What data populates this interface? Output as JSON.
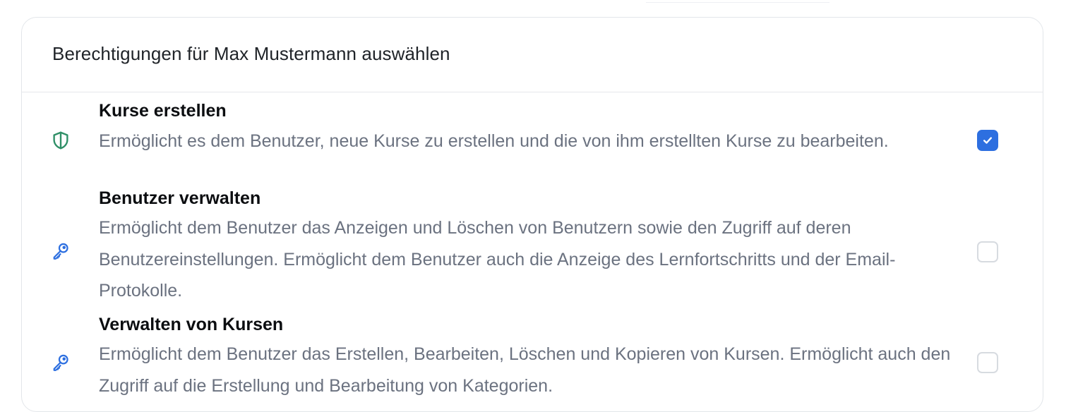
{
  "dialog": {
    "title": "Berechtigungen für Max Mustermann auswählen"
  },
  "permissions": [
    {
      "title": "Kurse erstellen",
      "description": "Ermöglicht es dem Benutzer, neue Kurse zu erstellen und die von ihm erstellten Kurse zu bearbeiten.",
      "icon": "shield-icon",
      "icon_color": "#2f8f67",
      "checked": true
    },
    {
      "title": "Benutzer verwalten",
      "description": "Ermöglicht dem Benutzer das Anzeigen und Löschen von Benutzern sowie den Zugriff auf deren Benutzereinstellungen. Ermöglicht dem Benutzer auch die Anzeige des Lernfortschritts und der Email-Protokolle.",
      "icon": "key-icon",
      "icon_color": "#2d6fe0",
      "checked": false
    },
    {
      "title": "Verwalten von Kursen",
      "description": "Ermöglicht dem Benutzer das Erstellen, Bearbeiten, Löschen und Kopieren von Kursen. Ermöglicht auch den Zugriff auf die Erstellung und Bearbeitung von Kategorien.",
      "icon": "key-icon",
      "icon_color": "#2d6fe0",
      "checked": false
    }
  ],
  "colors": {
    "checkbox_checked": "#2d6fe0",
    "checkbox_border": "#d7dbe0"
  }
}
